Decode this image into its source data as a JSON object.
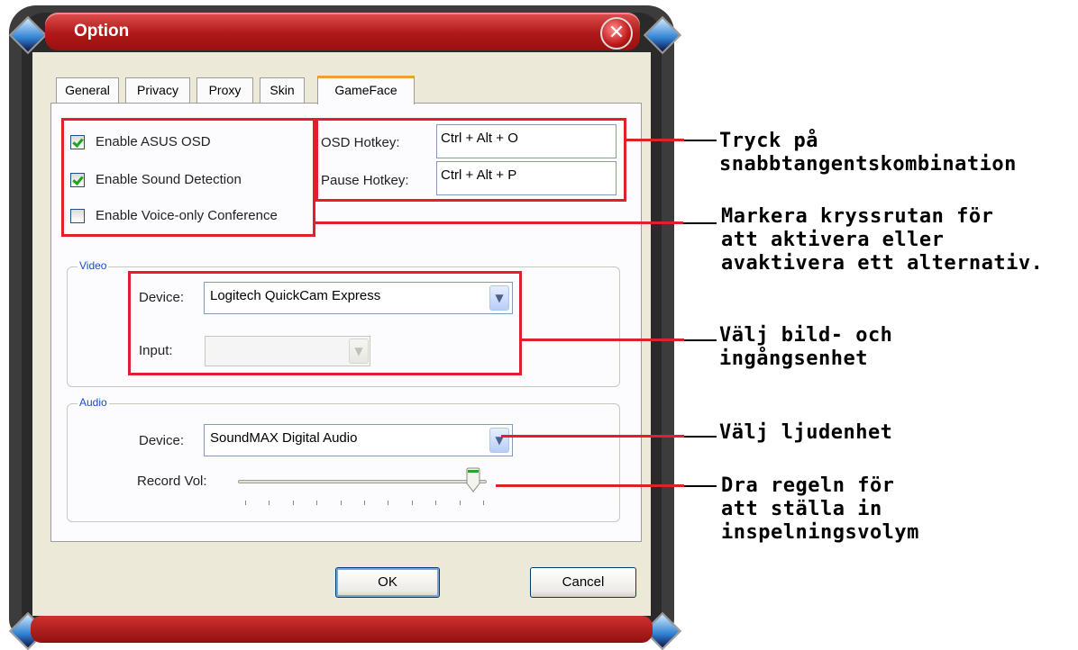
{
  "window": {
    "title": "Option",
    "close_symbol": "✕"
  },
  "tabs": [
    {
      "label": "General",
      "active": false
    },
    {
      "label": "Privacy",
      "active": false
    },
    {
      "label": "Proxy",
      "active": false
    },
    {
      "label": "Skin",
      "active": false
    },
    {
      "label": "GameFace",
      "active": true
    }
  ],
  "options": [
    {
      "label": "Enable ASUS OSD",
      "checked": true
    },
    {
      "label": "Enable Sound Detection",
      "checked": true
    },
    {
      "label": "Enable Voice-only Conference",
      "checked": false
    }
  ],
  "hotkeys": {
    "osd_label": "OSD Hotkey:",
    "osd_value": "Ctrl + Alt + O",
    "pause_label": "Pause Hotkey:",
    "pause_value": "Ctrl + Alt + P"
  },
  "video": {
    "group_title": "Video",
    "device_label": "Device:",
    "device_value": "Logitech QuickCam Express",
    "input_label": "Input:",
    "input_value": ""
  },
  "audio": {
    "group_title": "Audio",
    "device_label": "Device:",
    "device_value": "SoundMAX Digital Audio",
    "record_label": "Record Vol:",
    "record_level": 0.96
  },
  "buttons": {
    "ok": "OK",
    "cancel": "Cancel"
  },
  "callouts": {
    "hotkey": "Tryck på\nsnabbtangentskombination",
    "checkbox": "Markera kryssrutan för\natt aktivera eller\navaktivera ett alternativ.",
    "device": "Välj bild- och\ningångsenhet",
    "audio": "Välj ljudenhet",
    "volume": "Dra regeln för\natt ställa in\ninspelningsvolym"
  },
  "colors": {
    "highlight": "#e0202a",
    "title_bar": "#b01818",
    "active_tab": "#f0a030"
  },
  "icons": {
    "combo_arrow": "chevron-down-icon",
    "close": "close-icon"
  }
}
